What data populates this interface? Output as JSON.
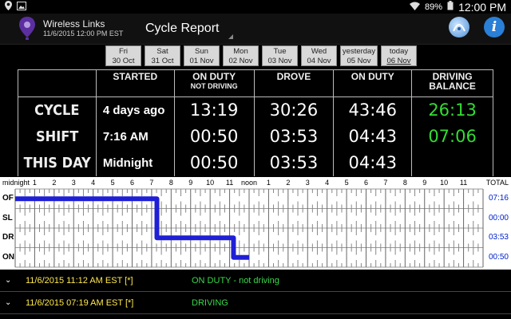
{
  "statusbar": {
    "battery": "89%",
    "time": "12:00 PM"
  },
  "appbar": {
    "app_name": "Wireless Links",
    "subtitle": "11/6/2015 12:00 PM EST",
    "screen_title": "Cycle Report"
  },
  "days": [
    {
      "l1": "Fri",
      "l2": "30 Oct"
    },
    {
      "l1": "Sat",
      "l2": "31 Oct"
    },
    {
      "l1": "Sun",
      "l2": "01 Nov"
    },
    {
      "l1": "Mon",
      "l2": "02 Nov"
    },
    {
      "l1": "Tue",
      "l2": "03 Nov"
    },
    {
      "l1": "Wed",
      "l2": "04 Nov"
    },
    {
      "l1": "yesterday",
      "l2": "05 Nov"
    },
    {
      "l1": "today",
      "l2": "06 Nov"
    }
  ],
  "summary": {
    "headers": {
      "started": "STARTED",
      "on_duty_not_driving": "ON DUTY",
      "on_duty_not_driving_sub": "NOT DRIVING",
      "drove": "DROVE",
      "on_duty": "ON DUTY",
      "driving_balance": "DRIVING",
      "driving_balance_2": "BALANCE"
    },
    "rows": [
      {
        "label": "CYCLE",
        "started": "4 days ago",
        "on_duty_nd": "13:19",
        "drove": "30:26",
        "on_duty": "43:46",
        "balance": "26:13"
      },
      {
        "label": "SHIFT",
        "started": "7:16 AM",
        "on_duty_nd": "00:50",
        "drove": "03:53",
        "on_duty": "04:43",
        "balance": "07:06"
      },
      {
        "label": "THIS DAY",
        "started": "Midnight",
        "on_duty_nd": "00:50",
        "drove": "03:53",
        "on_duty": "04:43",
        "balance": ""
      }
    ]
  },
  "graph": {
    "hour_labels": [
      "midnight",
      "1",
      "2",
      "3",
      "4",
      "5",
      "6",
      "7",
      "8",
      "9",
      "10",
      "11",
      "noon",
      "1",
      "2",
      "3",
      "4",
      "5",
      "6",
      "7",
      "8",
      "9",
      "10",
      "11"
    ],
    "total_label": "TOTAL",
    "rows": [
      "OF",
      "SL",
      "DR",
      "ON"
    ],
    "totals": [
      "07:16",
      "00:00",
      "03:53",
      "00:50"
    ],
    "segments_hours": [
      {
        "status": "OF",
        "start": 0,
        "end": 7.27
      },
      {
        "status": "DR",
        "start": 7.27,
        "end": 11.2
      },
      {
        "status": "ON",
        "start": 11.2,
        "end": 12.0
      }
    ],
    "line_color": "#1f1fd6"
  },
  "events": [
    {
      "when": "11/6/2015 11:12 AM EST [*]",
      "what": "ON DUTY - not driving"
    },
    {
      "when": "11/6/2015 07:19 AM EST [*]",
      "what": "DRIVING"
    }
  ]
}
